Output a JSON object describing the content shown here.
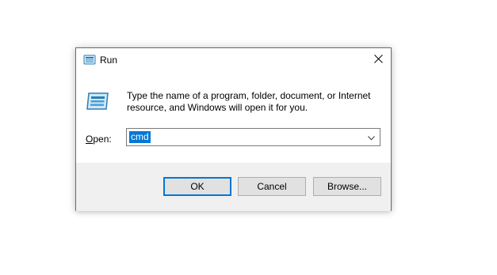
{
  "window": {
    "title": "Run",
    "icon": "run-icon",
    "close_icon": "close-icon"
  },
  "content": {
    "description": "Type the name of a program, folder, document, or Internet resource, and Windows will open it for you.",
    "open_label_accel": "O",
    "open_label_rest": "pen:",
    "open_value": "cmd"
  },
  "buttons": {
    "ok": "OK",
    "cancel": "Cancel",
    "browse": "Browse..."
  },
  "colors": {
    "accent": "#0078d7",
    "footer_bg": "#f0f0f0",
    "button_bg": "#e1e1e1"
  }
}
